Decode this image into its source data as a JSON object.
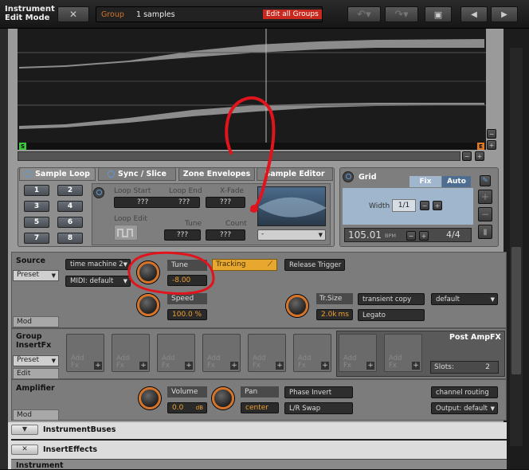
{
  "header": {
    "title_line1": "Instrument",
    "title_line2": "Edit Mode",
    "close_glyph": "✕",
    "group_label": "Group",
    "samples_count": "1 samples",
    "edit_all_groups": "Edit all Groups"
  },
  "sample_panel": {
    "tabs": [
      "Sample Loop",
      "Sync / Slice",
      "Zone Envelopes",
      "Sample Editor"
    ],
    "loop_numbers": [
      "1",
      "2",
      "3",
      "4",
      "5",
      "6",
      "7",
      "8"
    ],
    "loop_start_label": "Loop Start",
    "loop_end_label": "Loop End",
    "xfade_label": "X-Fade",
    "loop_start_value": "???",
    "loop_end_value": "???",
    "xfade_value": "???",
    "loop_edit_label": "Loop Edit",
    "tune_label": "Tune",
    "count_label": "Count",
    "tune_value": "???",
    "count_value": "???",
    "dropdown_value": "-"
  },
  "grid_panel": {
    "title": "Grid",
    "fix": "Fix",
    "auto": "Auto",
    "width_label": "Width",
    "width_value": "1/1",
    "bpm_value": "105.01",
    "bpm_unit": "BPM",
    "time_sig": "4/4"
  },
  "source": {
    "title": "Source",
    "preset": "Preset",
    "mode": "time machine 2",
    "midi": "MIDI: default",
    "tune_label": "Tune",
    "tune_value": "-8.00",
    "tracking": "Tracking",
    "release_trigger": "Release Trigger",
    "speed_label": "Speed",
    "speed_value": "100.0",
    "speed_unit": "%",
    "trsize_label": "Tr.Size",
    "trsize_value": "2.0k",
    "trsize_unit": "ms",
    "transient_copy": "transient copy",
    "default_select": "default",
    "legato": "Legato",
    "mod": "Mod"
  },
  "insert_fx": {
    "title_line1": "Group",
    "title_line2": "InsertFx",
    "preset": "Preset",
    "edit": "Edit",
    "slot_line1": "Add",
    "slot_line2": "Fx",
    "slot_plus": "+",
    "post_amp": "Post AmpFX",
    "slots_label": "Slots:",
    "slots_value": "2"
  },
  "amplifier": {
    "title": "Amplifier",
    "volume_label": "Volume",
    "volume_value": "0.0",
    "volume_unit": "dB",
    "pan_label": "Pan",
    "pan_value": "center",
    "phase_invert": "Phase Invert",
    "lr_swap": "L/R Swap",
    "channel_routing": "channel routing",
    "output": "Output: default",
    "mod": "Mod"
  },
  "buses": {
    "instrument_buses": "InstrumentBuses",
    "insert_effects": "InsertEffects",
    "instrument_partial": "Instrument"
  },
  "waveform_markers": {
    "start": "S",
    "end": "E"
  },
  "colors": {
    "accent_orange": "#d4742a",
    "annotation_red": "#e0141c",
    "edit_all_red": "#c8281e",
    "loop_green": "#3cc83c"
  }
}
